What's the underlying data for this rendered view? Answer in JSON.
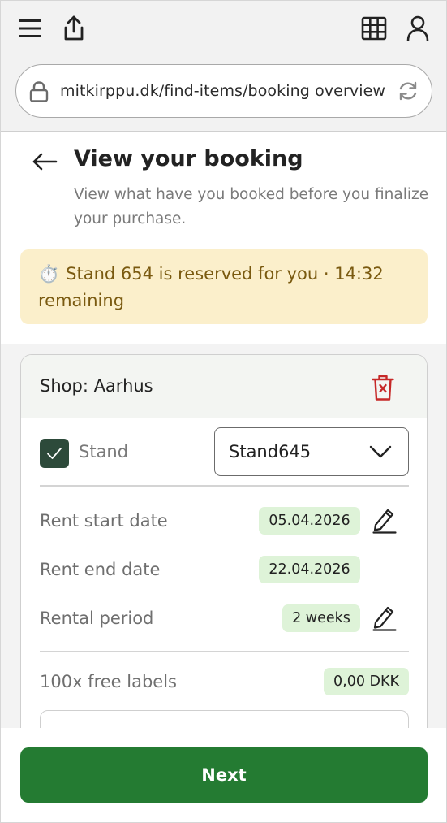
{
  "browser": {
    "url": "mitkirppu.dk/find-items/booking overview",
    "icons": [
      "menu-icon",
      "share-icon",
      "grid-icon",
      "user-icon",
      "lock-icon",
      "reload-icon"
    ]
  },
  "header": {
    "title": "View your booking",
    "subtitle": "View what have you booked before you finalize your purchase."
  },
  "timer": {
    "icon": "⏱️",
    "text": "Stand 654 is reserved for you · 14:32 remaining"
  },
  "card": {
    "shop": "Shop: Aarhus",
    "stand_label": "Stand",
    "stand_checked": true,
    "stand_select_value": "Stand645",
    "rows": [
      {
        "label": "Rent start date",
        "value": "05.04.2026",
        "editable": true
      },
      {
        "label": "Rent end date",
        "value": "22.04.2026",
        "editable": false
      },
      {
        "label": "Rental period",
        "value": "2 weeks",
        "editable": true
      }
    ],
    "labels_row": {
      "label": "100x free labels",
      "value": "0,00 DKK"
    }
  },
  "footer": {
    "next_label": "Next"
  },
  "colors": {
    "primary": "#247b32",
    "checkbox": "#2d4a3a",
    "pill": "#def3d8",
    "warning_bg": "#fbefcb",
    "warning_text": "#7a5a10",
    "danger": "#c62828"
  }
}
